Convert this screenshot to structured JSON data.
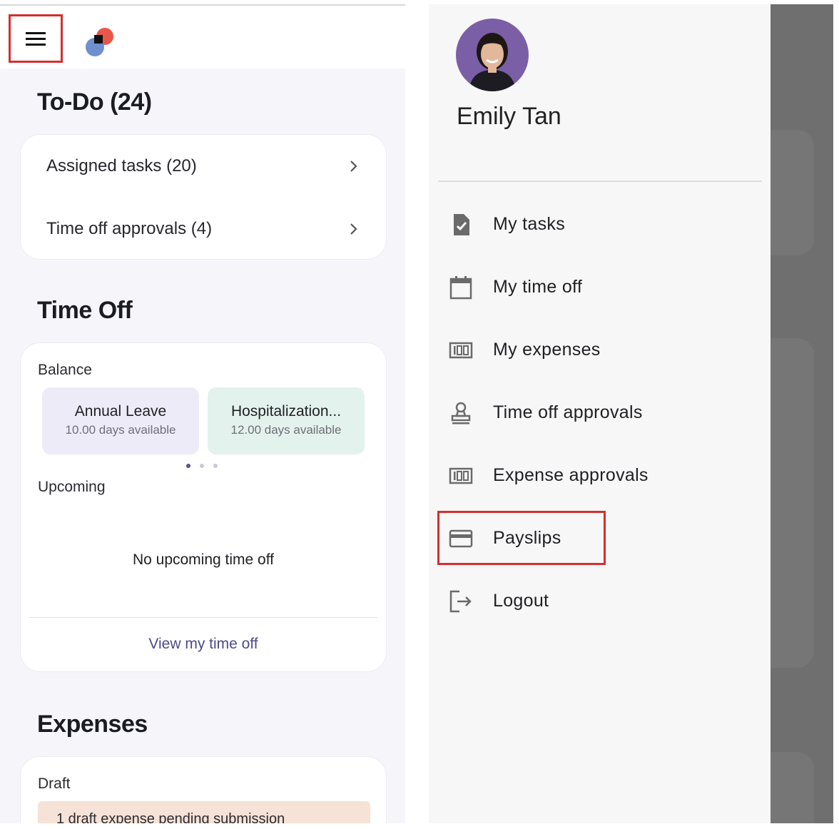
{
  "todo": {
    "title": "To-Do (24)",
    "items": [
      {
        "label": "Assigned tasks (20)"
      },
      {
        "label": "Time off approvals (4)"
      }
    ]
  },
  "time_off": {
    "title": "Time Off",
    "balance_label": "Balance",
    "balances": [
      {
        "name": "Annual Leave",
        "available": "10.00 days available",
        "color": "#eeebf8"
      },
      {
        "name": "Hospitalization...",
        "available": "12.00 days available",
        "color": "#e3f2ec"
      }
    ],
    "carousel_pages": 3,
    "carousel_active_index": 0,
    "upcoming_label": "Upcoming",
    "empty_message": "No upcoming time off",
    "view_link": "View my time off"
  },
  "expenses": {
    "title": "Expenses",
    "draft_label": "Draft",
    "draft_banner": "1 draft expense pending submission"
  },
  "drawer": {
    "user_name": "Emily Tan",
    "menu": [
      {
        "label": "My tasks",
        "icon": "task-check-icon"
      },
      {
        "label": "My time off",
        "icon": "calendar-icon"
      },
      {
        "label": "My expenses",
        "icon": "receipt-icon"
      },
      {
        "label": "Time off approvals",
        "icon": "stamp-icon"
      },
      {
        "label": "Expense approvals",
        "icon": "receipt-icon"
      },
      {
        "label": "Payslips",
        "icon": "card-icon"
      },
      {
        "label": "Logout",
        "icon": "logout-icon"
      }
    ]
  },
  "colors": {
    "highlight": "#d32f2f",
    "link": "#4b4a8a",
    "scrim": "#6f6f6f",
    "page_bg": "#f5f5fa"
  }
}
